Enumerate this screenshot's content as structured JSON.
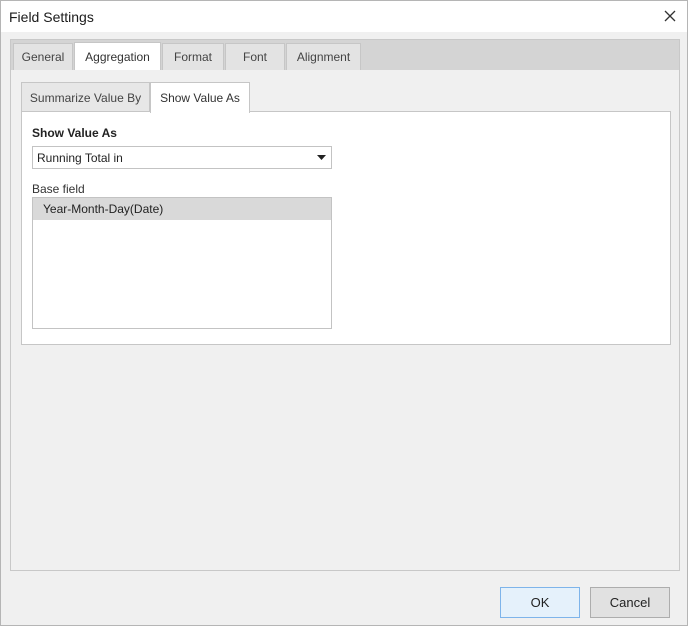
{
  "window": {
    "title": "Field Settings",
    "close_icon": "close-icon"
  },
  "outer_tabs": [
    {
      "label": "General",
      "active": false
    },
    {
      "label": "Aggregation",
      "active": true
    },
    {
      "label": "Format",
      "active": false
    },
    {
      "label": "Font",
      "active": false
    },
    {
      "label": "Alignment",
      "active": false
    }
  ],
  "inner_tabs": [
    {
      "label": "Summarize Value By",
      "active": false
    },
    {
      "label": "Show Value As",
      "active": true
    }
  ],
  "show_value_as": {
    "section_label": "Show Value As",
    "selected": "Running Total in",
    "dropdown_icon": "caret-down-icon"
  },
  "base_field": {
    "label": "Base field",
    "items": [
      "Year-Month-Day(Date)"
    ],
    "selected_index": 0
  },
  "buttons": {
    "ok_label": "OK",
    "cancel_label": "Cancel"
  },
  "colors": {
    "selected_item_bg": "#d9d9d9",
    "ok_button_border": "#7eb4ea",
    "ok_button_bg": "#e5f1fb"
  }
}
